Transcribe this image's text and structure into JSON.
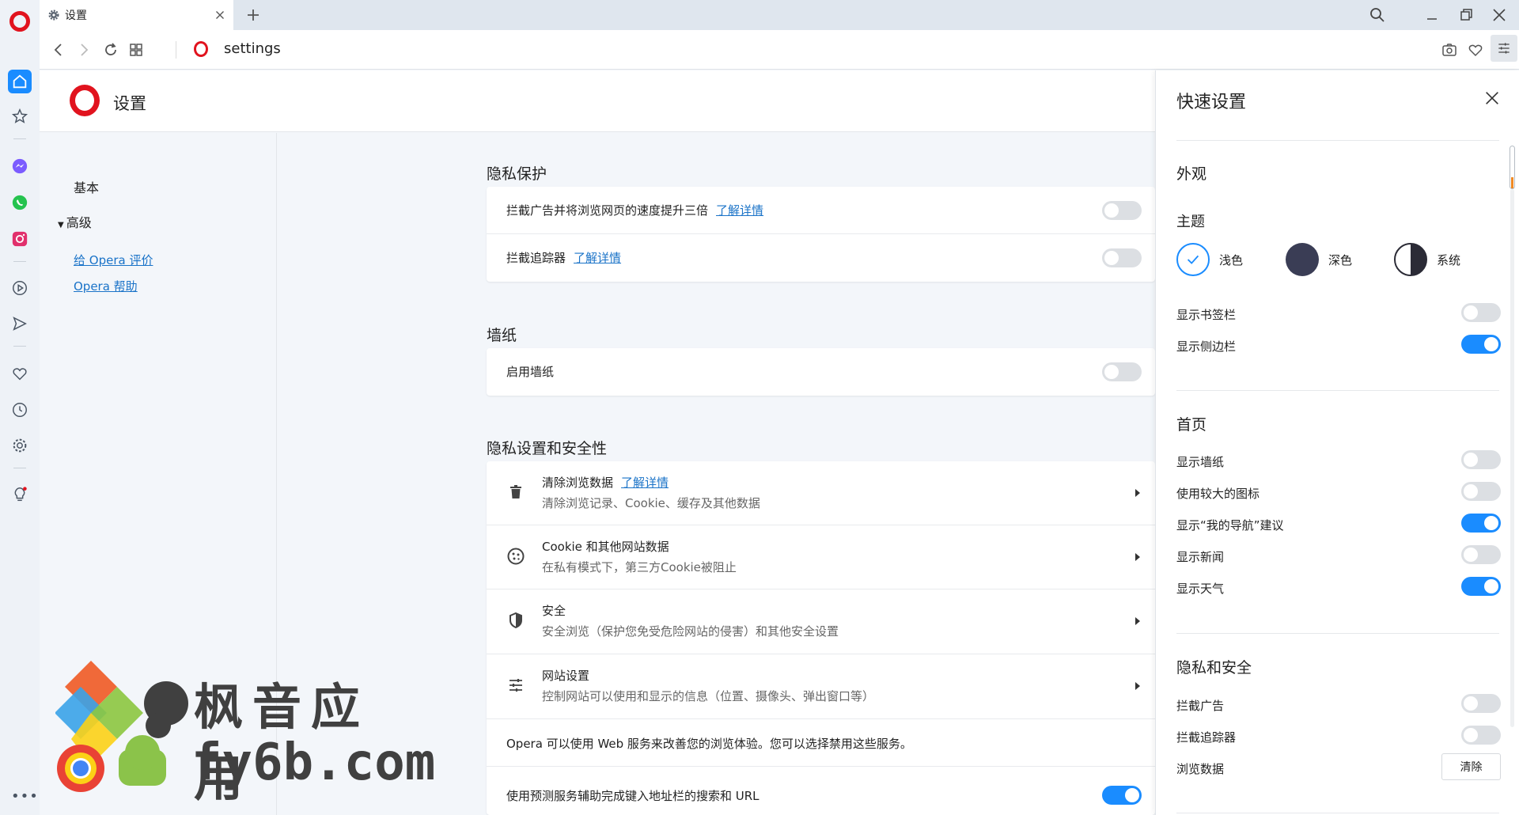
{
  "tab": {
    "title": "设置"
  },
  "address": {
    "text": "settings"
  },
  "page": {
    "title": "设置",
    "nav": {
      "basic": "基本",
      "advanced": "高级",
      "rate_link": "给 Opera 评价",
      "help_link": "Opera 帮助"
    }
  },
  "privacy": {
    "title": "隐私保护",
    "block_ads": "拦截广告并将浏览网页的速度提升三倍",
    "block_trackers": "拦截追踪器",
    "learn_more": "了解详情"
  },
  "wallpaper": {
    "title": "墙纸",
    "enable": "启用墙纸"
  },
  "security": {
    "title": "隐私设置和安全性",
    "rows": [
      {
        "title": "清除浏览数据",
        "link": "了解详情",
        "sub": "清除浏览记录、Cookie、缓存及其他数据"
      },
      {
        "title": "Cookie 和其他网站数据",
        "sub": "在私有模式下，第三方Cookie被阻止"
      },
      {
        "title": "安全",
        "sub": "安全浏览（保护您免受危险网站的侵害）和其他安全设置"
      },
      {
        "title": "网站设置",
        "sub": "控制网站可以使用和显示的信息（位置、摄像头、弹出窗口等）"
      }
    ],
    "services_note": "Opera 可以使用 Web 服务来改善您的浏览体验。您可以选择禁用这些服务。",
    "predict": "使用预测服务辅助完成键入地址栏的搜索和 URL"
  },
  "quick": {
    "title": "快速设置",
    "appearance": "外观",
    "theme_label": "主题",
    "themes": [
      "浅色",
      "深色",
      "系统"
    ],
    "show_bookmarks": "显示书签栏",
    "show_sidebar": "显示侧边栏",
    "home": "首页",
    "home_items": [
      "显示墙纸",
      "使用较大的图标",
      "显示“我的导航”建议",
      "显示新闻",
      "显示天气"
    ],
    "privacy_title": "隐私和安全",
    "block_ads": "拦截广告",
    "block_trackers": "拦截追踪器",
    "browsing_data": "浏览数据",
    "clear_button": "清除"
  },
  "toggles": {
    "page_block_ads": false,
    "page_block_trackers": false,
    "page_wallpaper": false,
    "page_predict": true,
    "qs_bookmarks": false,
    "qs_sidebar": true,
    "qs_home": [
      false,
      false,
      true,
      false,
      true
    ],
    "qs_block_ads": false,
    "qs_block_trackers": false
  },
  "watermark": {
    "line1": "枫音应用",
    "line2": "fy6b.com"
  },
  "colors": {
    "accent": "#1a8cff",
    "opera_red": "#e1131e",
    "link": "#1a73c8"
  }
}
